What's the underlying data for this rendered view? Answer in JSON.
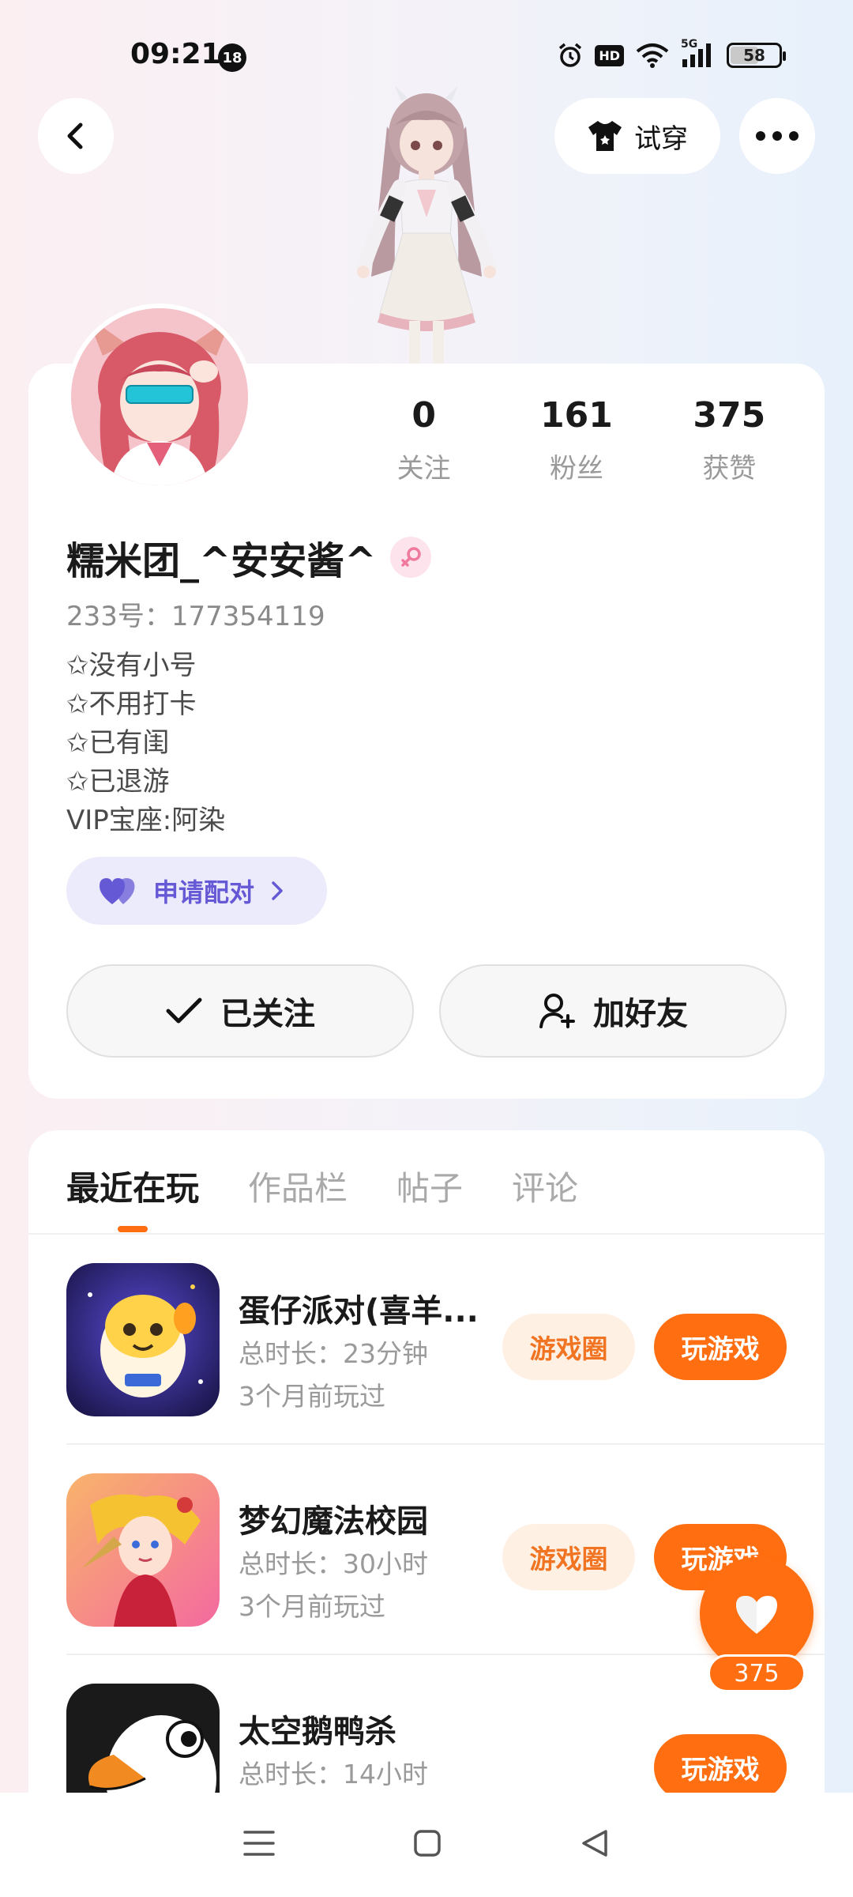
{
  "status_bar": {
    "time": "09:21",
    "notification_badge": "18",
    "hd_label": "HD",
    "network_label": "5G",
    "battery": "58",
    "battery_level": 0.58
  },
  "header": {
    "back_icon": "chevron-left-icon",
    "tryon_label": "试穿",
    "more_icon": "more-dots-icon"
  },
  "profile": {
    "nickname": "糯米团_^安安酱^",
    "gender": "female",
    "uid": "233号：177354119",
    "stats": [
      {
        "num": "0",
        "label": "关注"
      },
      {
        "num": "161",
        "label": "粉丝"
      },
      {
        "num": "375",
        "label": "获赞"
      }
    ],
    "bio": [
      "✩没有小号",
      "✩不用打卡",
      "✩已有闺",
      "✩已退游",
      "VIP宝座:阿染"
    ],
    "pair_label": "申请配对",
    "follow_label": "已关注",
    "add_friend_label": "加好友"
  },
  "tabs": [
    {
      "label": "最近在玩",
      "active": true
    },
    {
      "label": "作品栏",
      "active": false
    },
    {
      "label": "帖子",
      "active": false
    },
    {
      "label": "评论",
      "active": false
    }
  ],
  "games": [
    {
      "title": "蛋仔派对(喜羊...",
      "duration": "总时长：23分钟",
      "last_played": "3个月前玩过",
      "circle_label": "游戏圈",
      "play_label": "玩游戏"
    },
    {
      "title": "梦幻魔法校园",
      "duration": "总时长：30小时",
      "last_played": "3个月前玩过",
      "circle_label": "游戏圈",
      "play_label": "玩游戏"
    },
    {
      "title": "太空鹅鸭杀",
      "duration": "总时长：14小时",
      "last_played": "",
      "circle_label": "",
      "play_label": "玩游戏"
    }
  ],
  "like_float": {
    "count": "375"
  },
  "colors": {
    "accent": "#ff6e10",
    "pair_purple": "#6659d6"
  }
}
